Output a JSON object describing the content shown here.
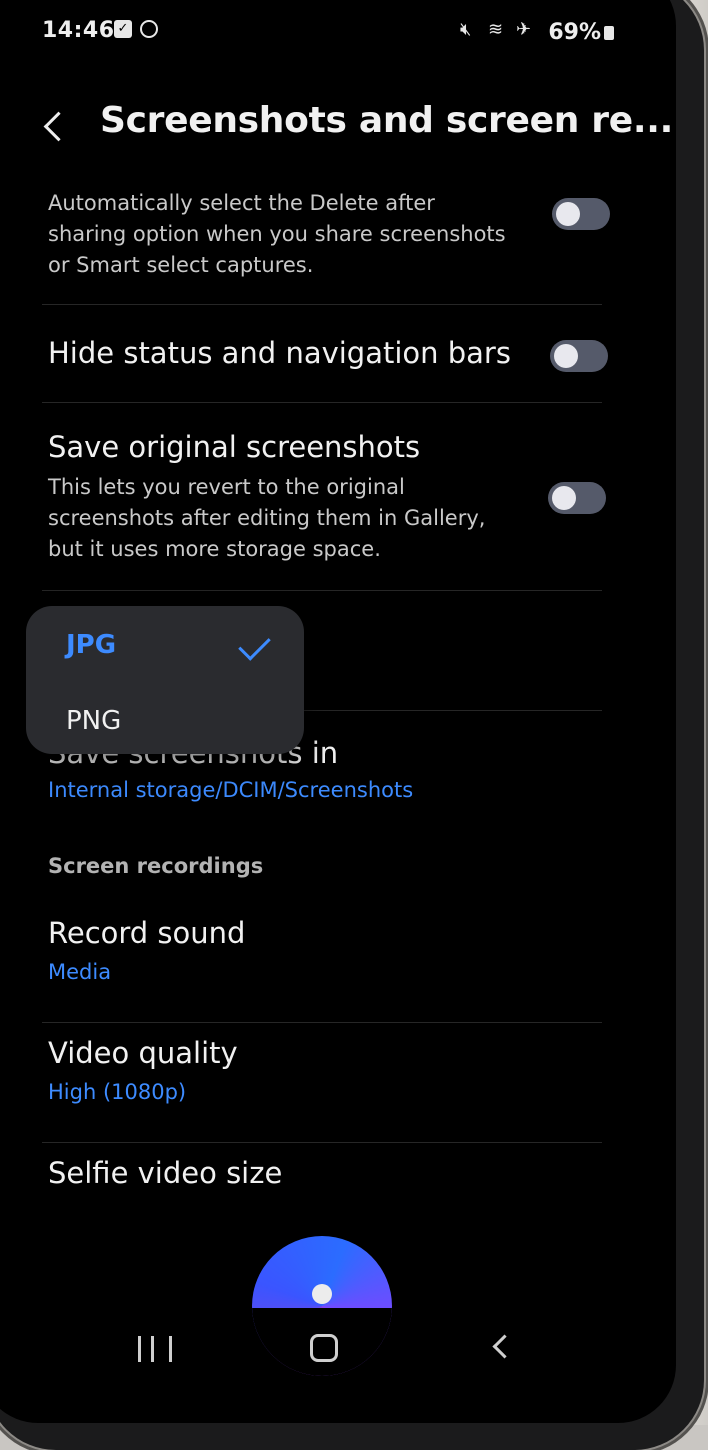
{
  "status_bar": {
    "time": "14:46",
    "battery": "69%",
    "icons": [
      "message-icon",
      "sync-icon",
      "mute-icon",
      "wifi-icon",
      "airplane-icon",
      "battery-icon"
    ]
  },
  "header": {
    "title": "Screenshots and screen re..."
  },
  "settings": {
    "delete_after_sharing": {
      "description": "Automatically select the Delete after sharing option when you share screenshots or Smart select captures.",
      "enabled": false
    },
    "hide_bars": {
      "title": "Hide status and navigation bars",
      "enabled": false
    },
    "save_original": {
      "title": "Save original screenshots",
      "description": "This lets you revert to the original screenshots after editing them in Gallery, but it uses more storage space.",
      "enabled": false
    },
    "save_in": {
      "title": "Save screenshots in",
      "value": "Internal storage/DCIM/Screenshots"
    }
  },
  "format_popup": {
    "options": [
      {
        "label": "JPG",
        "selected": true
      },
      {
        "label": "PNG",
        "selected": false
      }
    ]
  },
  "screen_recordings": {
    "section_title": "Screen recordings",
    "record_sound": {
      "title": "Record sound",
      "value": "Media"
    },
    "video_quality": {
      "title": "Video quality",
      "value": "High (1080p)"
    },
    "selfie_video_size": {
      "title": "Selfie video size"
    }
  },
  "colors": {
    "accent": "#3d8bff",
    "background": "#000000",
    "popup": "#2a2b2f",
    "toggle_off": "#555a6a"
  }
}
